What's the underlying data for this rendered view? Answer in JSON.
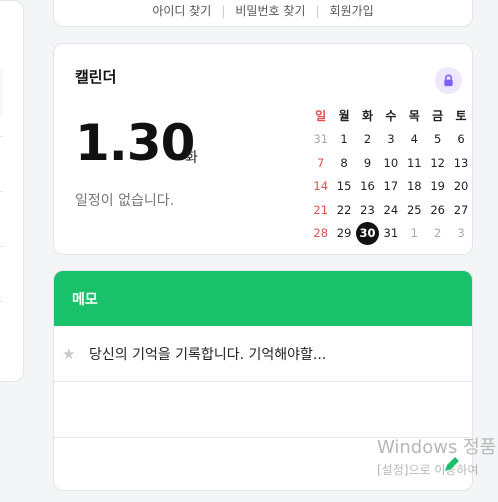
{
  "top_links": [
    "아이디 찾기",
    "비밀번호 찾기",
    "회원가입"
  ],
  "calendar": {
    "title": "캘린더",
    "big_date": "1.30",
    "big_day": "화",
    "no_event": "일정이 없습니다.",
    "weekdays": [
      "일",
      "월",
      "화",
      "수",
      "목",
      "금",
      "토"
    ],
    "weeks": [
      [
        "31",
        "1",
        "2",
        "3",
        "4",
        "5",
        "6"
      ],
      [
        "7",
        "8",
        "9",
        "10",
        "11",
        "12",
        "13"
      ],
      [
        "14",
        "15",
        "16",
        "17",
        "18",
        "19",
        "20"
      ],
      [
        "21",
        "22",
        "23",
        "24",
        "25",
        "26",
        "27"
      ],
      [
        "28",
        "29",
        "30",
        "31",
        "1",
        "2",
        "3"
      ]
    ],
    "today": "30",
    "accent_color": "#7b61ff"
  },
  "memo": {
    "title": "메모",
    "rows": [
      "당신의 기억을 기록합니다. 기억해야할...",
      "",
      ""
    ],
    "header_color": "#19c16a"
  },
  "windows_watermark": {
    "line1": "Windows 정품",
    "line2": "[설정]으로 이동하여"
  }
}
